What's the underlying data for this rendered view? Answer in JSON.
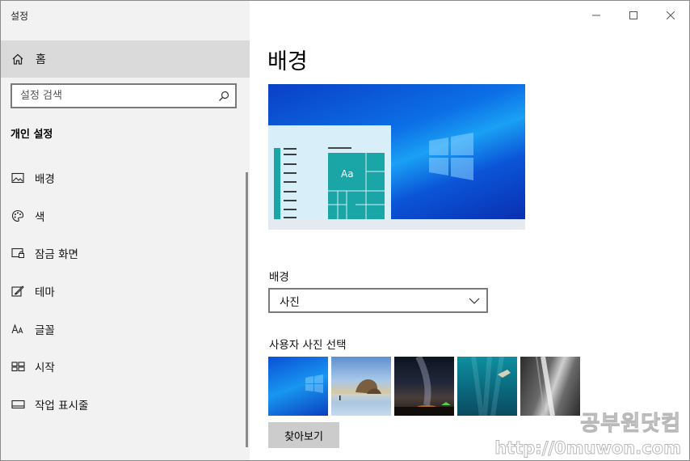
{
  "window": {
    "app_title": "설정",
    "controls": [
      "minimize-icon",
      "maximize-icon",
      "close-icon"
    ]
  },
  "sidebar": {
    "home_label": "홈",
    "search_placeholder": "설정 검색",
    "section_title": "개인 설정",
    "items": [
      {
        "label": "배경",
        "icon": "picture-icon"
      },
      {
        "label": "색",
        "icon": "palette-icon"
      },
      {
        "label": "잠금 화면",
        "icon": "lock-screen-icon"
      },
      {
        "label": "테마",
        "icon": "theme-brush-icon"
      },
      {
        "label": "글꼴",
        "icon": "font-icon"
      },
      {
        "label": "시작",
        "icon": "start-icon"
      },
      {
        "label": "작업 표시줄",
        "icon": "taskbar-icon"
      }
    ]
  },
  "main": {
    "page_title": "배경",
    "preview_tile_text": "Aa",
    "background_label": "배경",
    "background_dropdown_value": "사진",
    "choose_photo_label": "사용자 사진 선택",
    "browse_button": "찾아보기"
  },
  "watermark": {
    "line1": "공부원닷컴",
    "line2": "http://0muwon.com"
  },
  "colors": {
    "sidebar_bg": "#f2f2f2",
    "selected_bg": "#dadada",
    "accent_tile": "#1aa6a6",
    "button_bg": "#cccccc"
  }
}
